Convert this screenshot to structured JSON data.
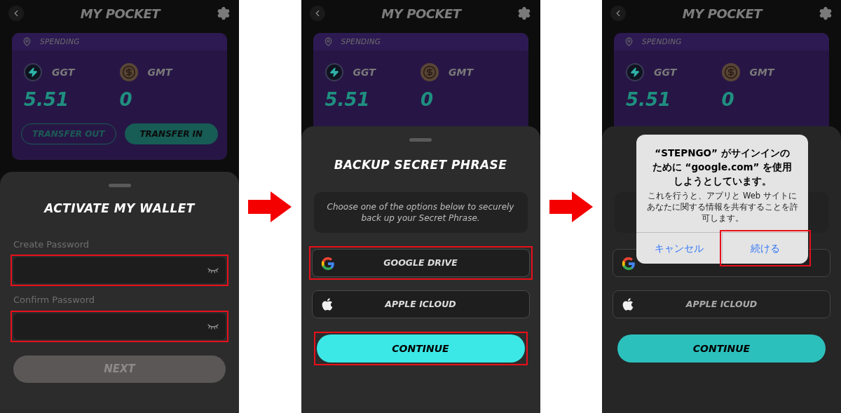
{
  "screens": [
    {
      "header": {
        "title": "MY POCKET"
      },
      "wallet": {
        "label": "SPENDING",
        "tokens": [
          {
            "name": "GGT",
            "amount": "5.51",
            "kind": "bolt"
          },
          {
            "name": "GMT",
            "amount": "0",
            "kind": "coin"
          }
        ],
        "buttons": [
          {
            "label": "TRANSFER OUT",
            "kind": "outline"
          },
          {
            "label": "TRANSFER IN",
            "kind": "filled"
          }
        ]
      },
      "sheet": {
        "kind": "password",
        "title": "ACTIVATE MY WALLET",
        "fields": [
          {
            "label": "Create Password",
            "highlighted": true
          },
          {
            "label": "Confirm Password",
            "highlighted": true
          }
        ],
        "next": {
          "label": "NEXT",
          "disabled": true
        }
      }
    },
    {
      "header": {
        "title": "MY POCKET"
      },
      "wallet": {
        "label": "SPENDING",
        "tokens": [
          {
            "name": "GGT",
            "amount": "5.51",
            "kind": "bolt"
          },
          {
            "name": "GMT",
            "amount": "0",
            "kind": "coin"
          }
        ]
      },
      "sheet": {
        "kind": "backup",
        "title": "BACKUP SECRET PHRASE",
        "description": "Choose one of the options below to securely back up your Secret Phrase.",
        "options": [
          {
            "label": "GOOGLE DRIVE",
            "kind": "google",
            "highlighted": true
          },
          {
            "label": "APPLE ICLOUD",
            "kind": "apple",
            "highlighted": false
          }
        ],
        "continue": {
          "label": "CONTINUE",
          "highlighted": true
        }
      }
    },
    {
      "header": {
        "title": "MY POCKET"
      },
      "wallet": {
        "label": "SPENDING",
        "tokens": [
          {
            "name": "GGT",
            "amount": "5.51",
            "kind": "bolt"
          },
          {
            "name": "GMT",
            "amount": "0",
            "kind": "coin"
          }
        ]
      },
      "sheet": {
        "kind": "backup",
        "options": [
          {
            "kind": "google",
            "highlighted": false
          },
          {
            "label": "APPLE ICLOUD",
            "kind": "apple",
            "highlighted": false
          }
        ],
        "continue": {
          "label": "CONTINUE",
          "highlighted": false
        }
      },
      "dialog": {
        "title": "“STEPNGO” がサインインのために “google.com” を使用しようとしています。",
        "message": "これを行うと、アプリと Web サイトにあなたに関する情報を共有することを許可します。",
        "buttons": [
          {
            "label": "キャンセル",
            "highlighted": false
          },
          {
            "label": "続ける",
            "highlighted": true
          }
        ]
      }
    }
  ]
}
